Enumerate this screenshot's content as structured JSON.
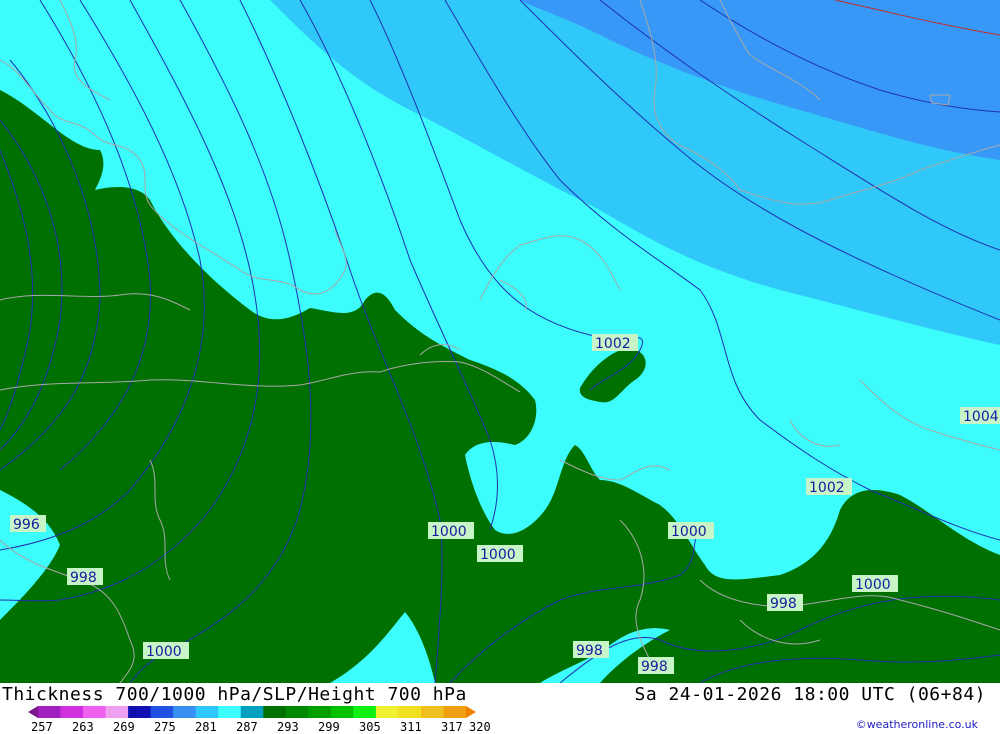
{
  "title": "Thickness 700/1000 hPa/SLP/Height 700 hPa",
  "datetime": "Sa 24-01-2026 18:00 UTC (06+84)",
  "credit": "©weatheronline.co.uk",
  "colors": {
    "green": "#007000",
    "cyan": "#3cfcfc",
    "sky": "#30c8f8",
    "blue": "#3898f8",
    "coast": "#a8a8a8",
    "isobar": "#2030b0",
    "redline": "#c03030"
  },
  "isobar_labels": [
    {
      "text": "1002"
    },
    {
      "text": "1004"
    },
    {
      "text": "1002"
    },
    {
      "text": "996"
    },
    {
      "text": "998"
    },
    {
      "text": "1000"
    },
    {
      "text": "1000"
    },
    {
      "text": "1000"
    },
    {
      "text": "1000"
    },
    {
      "text": "998"
    },
    {
      "text": "1000"
    },
    {
      "text": "998"
    },
    {
      "text": "998"
    }
  ],
  "legend": {
    "colors": [
      "#7a1a8a",
      "#a020c0",
      "#d030e0",
      "#f060f0",
      "#f0a0f0",
      "#1010b0",
      "#2050e0",
      "#3890f0",
      "#30c8f8",
      "#3cfcfc",
      "#00a0c0",
      "#007000",
      "#008800",
      "#00a000",
      "#00c000",
      "#10f010",
      "#f0f030",
      "#f0e020",
      "#f0c020",
      "#f0a010",
      "#f08000"
    ],
    "ticks": [
      "257",
      "263",
      "269",
      "275",
      "281",
      "287",
      "293",
      "299",
      "305",
      "311",
      "317",
      "320"
    ]
  }
}
